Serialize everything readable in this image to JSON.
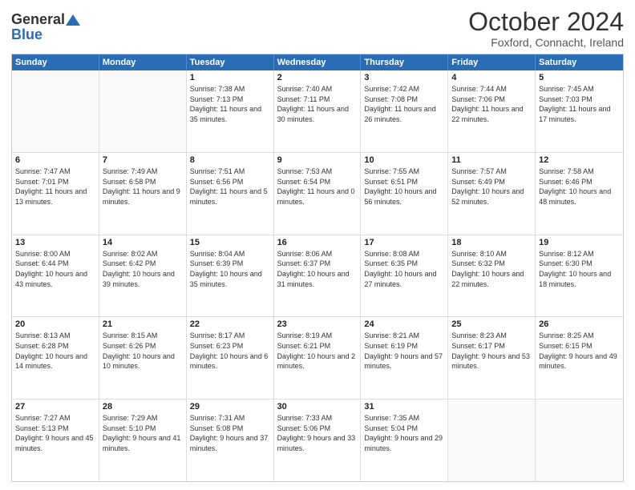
{
  "header": {
    "logo_general": "General",
    "logo_blue": "Blue",
    "month_title": "October 2024",
    "location": "Foxford, Connacht, Ireland"
  },
  "weekdays": [
    "Sunday",
    "Monday",
    "Tuesday",
    "Wednesday",
    "Thursday",
    "Friday",
    "Saturday"
  ],
  "rows": [
    [
      {
        "day": "",
        "sunrise": "",
        "sunset": "",
        "daylight": ""
      },
      {
        "day": "",
        "sunrise": "",
        "sunset": "",
        "daylight": ""
      },
      {
        "day": "1",
        "sunrise": "Sunrise: 7:38 AM",
        "sunset": "Sunset: 7:13 PM",
        "daylight": "Daylight: 11 hours and 35 minutes."
      },
      {
        "day": "2",
        "sunrise": "Sunrise: 7:40 AM",
        "sunset": "Sunset: 7:11 PM",
        "daylight": "Daylight: 11 hours and 30 minutes."
      },
      {
        "day": "3",
        "sunrise": "Sunrise: 7:42 AM",
        "sunset": "Sunset: 7:08 PM",
        "daylight": "Daylight: 11 hours and 26 minutes."
      },
      {
        "day": "4",
        "sunrise": "Sunrise: 7:44 AM",
        "sunset": "Sunset: 7:06 PM",
        "daylight": "Daylight: 11 hours and 22 minutes."
      },
      {
        "day": "5",
        "sunrise": "Sunrise: 7:45 AM",
        "sunset": "Sunset: 7:03 PM",
        "daylight": "Daylight: 11 hours and 17 minutes."
      }
    ],
    [
      {
        "day": "6",
        "sunrise": "Sunrise: 7:47 AM",
        "sunset": "Sunset: 7:01 PM",
        "daylight": "Daylight: 11 hours and 13 minutes."
      },
      {
        "day": "7",
        "sunrise": "Sunrise: 7:49 AM",
        "sunset": "Sunset: 6:58 PM",
        "daylight": "Daylight: 11 hours and 9 minutes."
      },
      {
        "day": "8",
        "sunrise": "Sunrise: 7:51 AM",
        "sunset": "Sunset: 6:56 PM",
        "daylight": "Daylight: 11 hours and 5 minutes."
      },
      {
        "day": "9",
        "sunrise": "Sunrise: 7:53 AM",
        "sunset": "Sunset: 6:54 PM",
        "daylight": "Daylight: 11 hours and 0 minutes."
      },
      {
        "day": "10",
        "sunrise": "Sunrise: 7:55 AM",
        "sunset": "Sunset: 6:51 PM",
        "daylight": "Daylight: 10 hours and 56 minutes."
      },
      {
        "day": "11",
        "sunrise": "Sunrise: 7:57 AM",
        "sunset": "Sunset: 6:49 PM",
        "daylight": "Daylight: 10 hours and 52 minutes."
      },
      {
        "day": "12",
        "sunrise": "Sunrise: 7:58 AM",
        "sunset": "Sunset: 6:46 PM",
        "daylight": "Daylight: 10 hours and 48 minutes."
      }
    ],
    [
      {
        "day": "13",
        "sunrise": "Sunrise: 8:00 AM",
        "sunset": "Sunset: 6:44 PM",
        "daylight": "Daylight: 10 hours and 43 minutes."
      },
      {
        "day": "14",
        "sunrise": "Sunrise: 8:02 AM",
        "sunset": "Sunset: 6:42 PM",
        "daylight": "Daylight: 10 hours and 39 minutes."
      },
      {
        "day": "15",
        "sunrise": "Sunrise: 8:04 AM",
        "sunset": "Sunset: 6:39 PM",
        "daylight": "Daylight: 10 hours and 35 minutes."
      },
      {
        "day": "16",
        "sunrise": "Sunrise: 8:06 AM",
        "sunset": "Sunset: 6:37 PM",
        "daylight": "Daylight: 10 hours and 31 minutes."
      },
      {
        "day": "17",
        "sunrise": "Sunrise: 8:08 AM",
        "sunset": "Sunset: 6:35 PM",
        "daylight": "Daylight: 10 hours and 27 minutes."
      },
      {
        "day": "18",
        "sunrise": "Sunrise: 8:10 AM",
        "sunset": "Sunset: 6:32 PM",
        "daylight": "Daylight: 10 hours and 22 minutes."
      },
      {
        "day": "19",
        "sunrise": "Sunrise: 8:12 AM",
        "sunset": "Sunset: 6:30 PM",
        "daylight": "Daylight: 10 hours and 18 minutes."
      }
    ],
    [
      {
        "day": "20",
        "sunrise": "Sunrise: 8:13 AM",
        "sunset": "Sunset: 6:28 PM",
        "daylight": "Daylight: 10 hours and 14 minutes."
      },
      {
        "day": "21",
        "sunrise": "Sunrise: 8:15 AM",
        "sunset": "Sunset: 6:26 PM",
        "daylight": "Daylight: 10 hours and 10 minutes."
      },
      {
        "day": "22",
        "sunrise": "Sunrise: 8:17 AM",
        "sunset": "Sunset: 6:23 PM",
        "daylight": "Daylight: 10 hours and 6 minutes."
      },
      {
        "day": "23",
        "sunrise": "Sunrise: 8:19 AM",
        "sunset": "Sunset: 6:21 PM",
        "daylight": "Daylight: 10 hours and 2 minutes."
      },
      {
        "day": "24",
        "sunrise": "Sunrise: 8:21 AM",
        "sunset": "Sunset: 6:19 PM",
        "daylight": "Daylight: 9 hours and 57 minutes."
      },
      {
        "day": "25",
        "sunrise": "Sunrise: 8:23 AM",
        "sunset": "Sunset: 6:17 PM",
        "daylight": "Daylight: 9 hours and 53 minutes."
      },
      {
        "day": "26",
        "sunrise": "Sunrise: 8:25 AM",
        "sunset": "Sunset: 6:15 PM",
        "daylight": "Daylight: 9 hours and 49 minutes."
      }
    ],
    [
      {
        "day": "27",
        "sunrise": "Sunrise: 7:27 AM",
        "sunset": "Sunset: 5:13 PM",
        "daylight": "Daylight: 9 hours and 45 minutes."
      },
      {
        "day": "28",
        "sunrise": "Sunrise: 7:29 AM",
        "sunset": "Sunset: 5:10 PM",
        "daylight": "Daylight: 9 hours and 41 minutes."
      },
      {
        "day": "29",
        "sunrise": "Sunrise: 7:31 AM",
        "sunset": "Sunset: 5:08 PM",
        "daylight": "Daylight: 9 hours and 37 minutes."
      },
      {
        "day": "30",
        "sunrise": "Sunrise: 7:33 AM",
        "sunset": "Sunset: 5:06 PM",
        "daylight": "Daylight: 9 hours and 33 minutes."
      },
      {
        "day": "31",
        "sunrise": "Sunrise: 7:35 AM",
        "sunset": "Sunset: 5:04 PM",
        "daylight": "Daylight: 9 hours and 29 minutes."
      },
      {
        "day": "",
        "sunrise": "",
        "sunset": "",
        "daylight": ""
      },
      {
        "day": "",
        "sunrise": "",
        "sunset": "",
        "daylight": ""
      }
    ]
  ]
}
